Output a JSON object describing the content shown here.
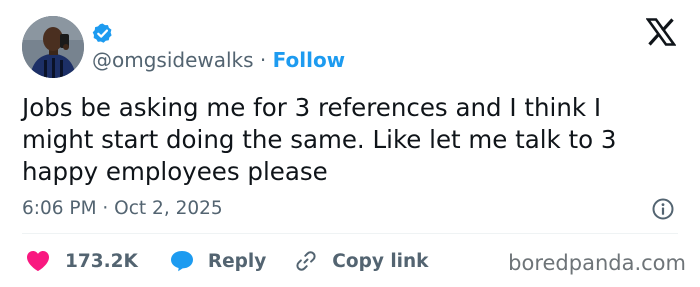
{
  "author": {
    "handle": "@omgsidewalks",
    "separator": "·",
    "follow_label": "Follow",
    "verified": true
  },
  "tweet": {
    "text": "Jobs be asking me for 3 references and I think I might start doing the same. Like let me talk to 3 happy employees please",
    "timestamp": "6:06 PM · Oct 2, 2025"
  },
  "actions": {
    "likes_count": "173.2K",
    "reply_label": "Reply",
    "copy_link_label": "Copy link"
  },
  "watermark": "boredpanda.com",
  "icons": {
    "avatar": "profile-photo",
    "verified": "verified-badge-icon",
    "logo": "x-logo-icon",
    "info": "info-icon",
    "like": "heart-icon",
    "reply": "speech-bubble-icon",
    "copy": "link-icon"
  },
  "colors": {
    "accent": "#1d9bf0",
    "like": "#f91880",
    "text": "#0f1419",
    "muted": "#536471"
  }
}
